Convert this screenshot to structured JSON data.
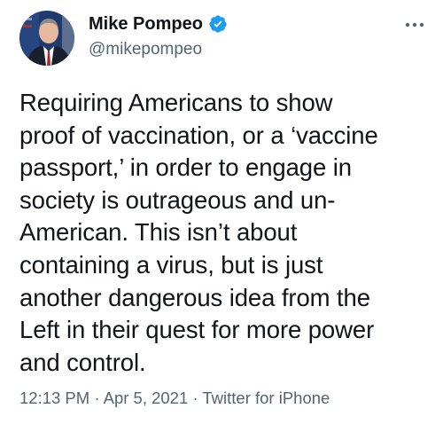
{
  "author": {
    "display_name": "Mike Pompeo",
    "handle": "@mikepompeo",
    "verified": true
  },
  "tweet": {
    "text": "Requiring Americans to show\nproof of vaccination, or a ‘vaccine\npassport,’ in order to engage in\nsociety is outrageous and un-\nAmerican. This isn’t about\ncontaining a virus, but is just\nanother dangerous idea from the\nLeft in their quest for more power\nand control."
  },
  "meta": {
    "time": "12:13 PM",
    "date": "Apr 5, 2021",
    "source": "Twitter for iPhone",
    "separator": " · "
  },
  "icons": {
    "verified": "verified-badge-icon",
    "more": "more-options-icon"
  },
  "colors": {
    "text": "#0f1419",
    "secondary": "#536471",
    "verified": "#1d9bf0"
  }
}
